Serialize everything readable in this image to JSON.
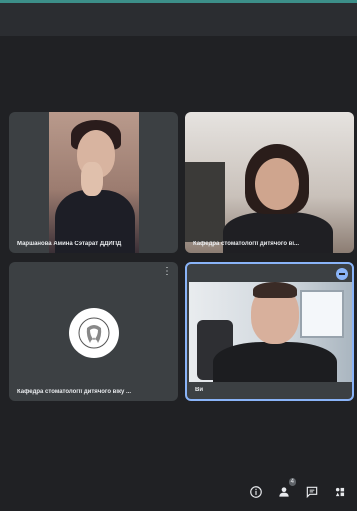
{
  "participants": [
    {
      "label": "Маршанова Амина Сэтарат ДДИПД",
      "type": "video"
    },
    {
      "label": "Кафедра стоматології дитячого ві...",
      "type": "video"
    },
    {
      "label": "Кафедра стоматології дитячого віку ...",
      "type": "avatar"
    },
    {
      "label": "Ви",
      "type": "video",
      "self": true
    }
  ],
  "controls": {
    "participants_count": "4",
    "icons": [
      "info-icon",
      "people-icon",
      "chat-icon",
      "activities-icon"
    ]
  },
  "colors": {
    "background": "#202124",
    "tile": "#3c4043",
    "accent": "#8ab4f8",
    "top_stripe": "#3c8f89"
  }
}
